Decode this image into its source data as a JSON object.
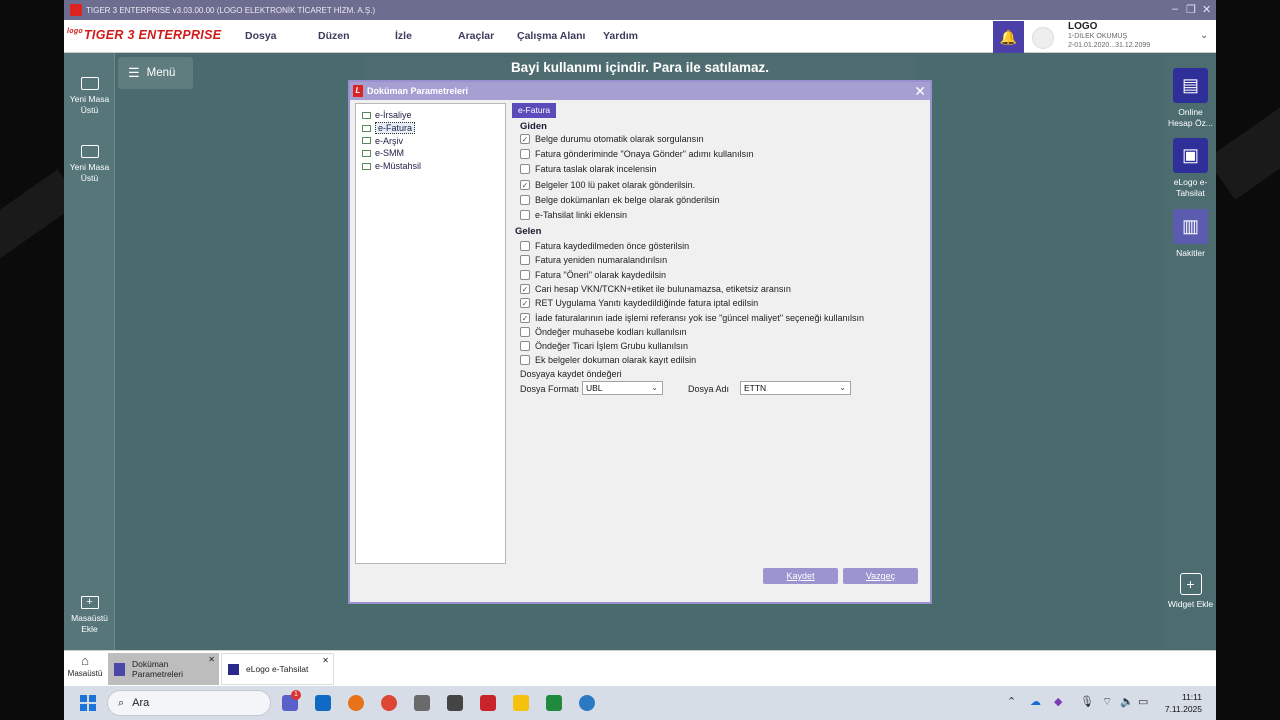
{
  "window": {
    "title": "TIGER 3 ENTERPRISE v3.03.00.00 (LOGO ELEKTRONİK TİCARET HİZM. A.Ş.)"
  },
  "brand": "TIGER 3 ENTERPRISE",
  "brand_prefix": "logo",
  "menu": [
    "Dosya",
    "Düzen",
    "İzle",
    "Araçlar",
    "Çalışma Alanı",
    "Yardım"
  ],
  "user": {
    "company": "LOGO",
    "name": "1-DİLEK OKUMUŞ",
    "period": "2-01.01.2020...31.12.2099"
  },
  "left_sidebar": {
    "menu_label": "Menü",
    "items": [
      "Yeni Masa Üstü",
      "Yeni Masa Üstü"
    ],
    "add_desktop": "Masaüstü Ekle"
  },
  "right_sidebar": {
    "items": [
      "Online Hesap Öz...",
      "eLogo e-Tahsilat",
      "Nakitler"
    ],
    "widget": "Widget Ekle"
  },
  "banner": "Bayi kullanımı içindir. Para ile satılamaz.",
  "dialog": {
    "title": "Doküman Parametreleri",
    "tree": [
      "e-İrsaliye",
      "e-Fatura",
      "e-Arşiv",
      "e-SMM",
      "e-Müstahsil"
    ],
    "tree_selected": "e-Fatura",
    "tab": "e-Fatura",
    "giden_header": "Giden",
    "giden": [
      {
        "label": "Belge durumu otomatik olarak sorgulansın",
        "checked": true
      },
      {
        "label": "Fatura gönderiminde \"Onaya Gönder\" adımı kullanılsın",
        "checked": false
      },
      {
        "label": "Fatura taslak olarak incelensin",
        "checked": false
      },
      {
        "label": "Belgeler 100 lü paket olarak gönderilsin.",
        "checked": true
      },
      {
        "label": "Belge dokümanları ek belge olarak gönderilsin",
        "checked": false
      },
      {
        "label": "e-Tahsilat linki eklensin",
        "checked": false
      }
    ],
    "gelen_header": "Gelen",
    "gelen": [
      {
        "label": "Fatura kaydedilmeden önce gösterilsin",
        "checked": false
      },
      {
        "label": "Fatura yeniden numaralandırılsın",
        "checked": false
      },
      {
        "label": "Fatura \"Öneri\" olarak kaydedilsin",
        "checked": false
      },
      {
        "label": "Cari hesap VKN/TCKN+etiket ile bulunamazsa, etiketsiz aransın",
        "checked": true
      },
      {
        "label": "RET Uygulama Yanıtı kaydedildiğinde fatura iptal edilsin",
        "checked": true
      },
      {
        "label": "İade faturalarının iade işlemi referansı yok ise \"güncel maliyet\" seçeneği kullanılsın",
        "checked": true
      },
      {
        "label": "Öndeğer muhasebe kodları kullanılsın",
        "checked": false
      },
      {
        "label": "Öndeğer Ticari İşlem Grubu kullanılsın",
        "checked": false
      },
      {
        "label": "Ek belgeler dokuman olarak kayıt edilsin",
        "checked": false
      }
    ],
    "save_defaults_label": "Dosyaya kaydet öndeğeri",
    "format_label": "Dosya Formatı",
    "format_value": "UBL",
    "name_label": "Dosya Adı",
    "name_value": "ETTN",
    "save_button": "Kaydet",
    "cancel_button": "Vazgeç"
  },
  "app_taskbar": {
    "home": "Masaüstü",
    "tabs": [
      "Doküman Parametreleri",
      "eLogo e-Tahsilat"
    ]
  },
  "windows_taskbar": {
    "search_placeholder": "Ara",
    "time": "11:11",
    "date": "7.11.2025",
    "teams_badge": "1"
  },
  "colors": {
    "accent": "#5a4dbb",
    "brand_red": "#d21a1a",
    "app_bg": "#4a6b6e"
  }
}
